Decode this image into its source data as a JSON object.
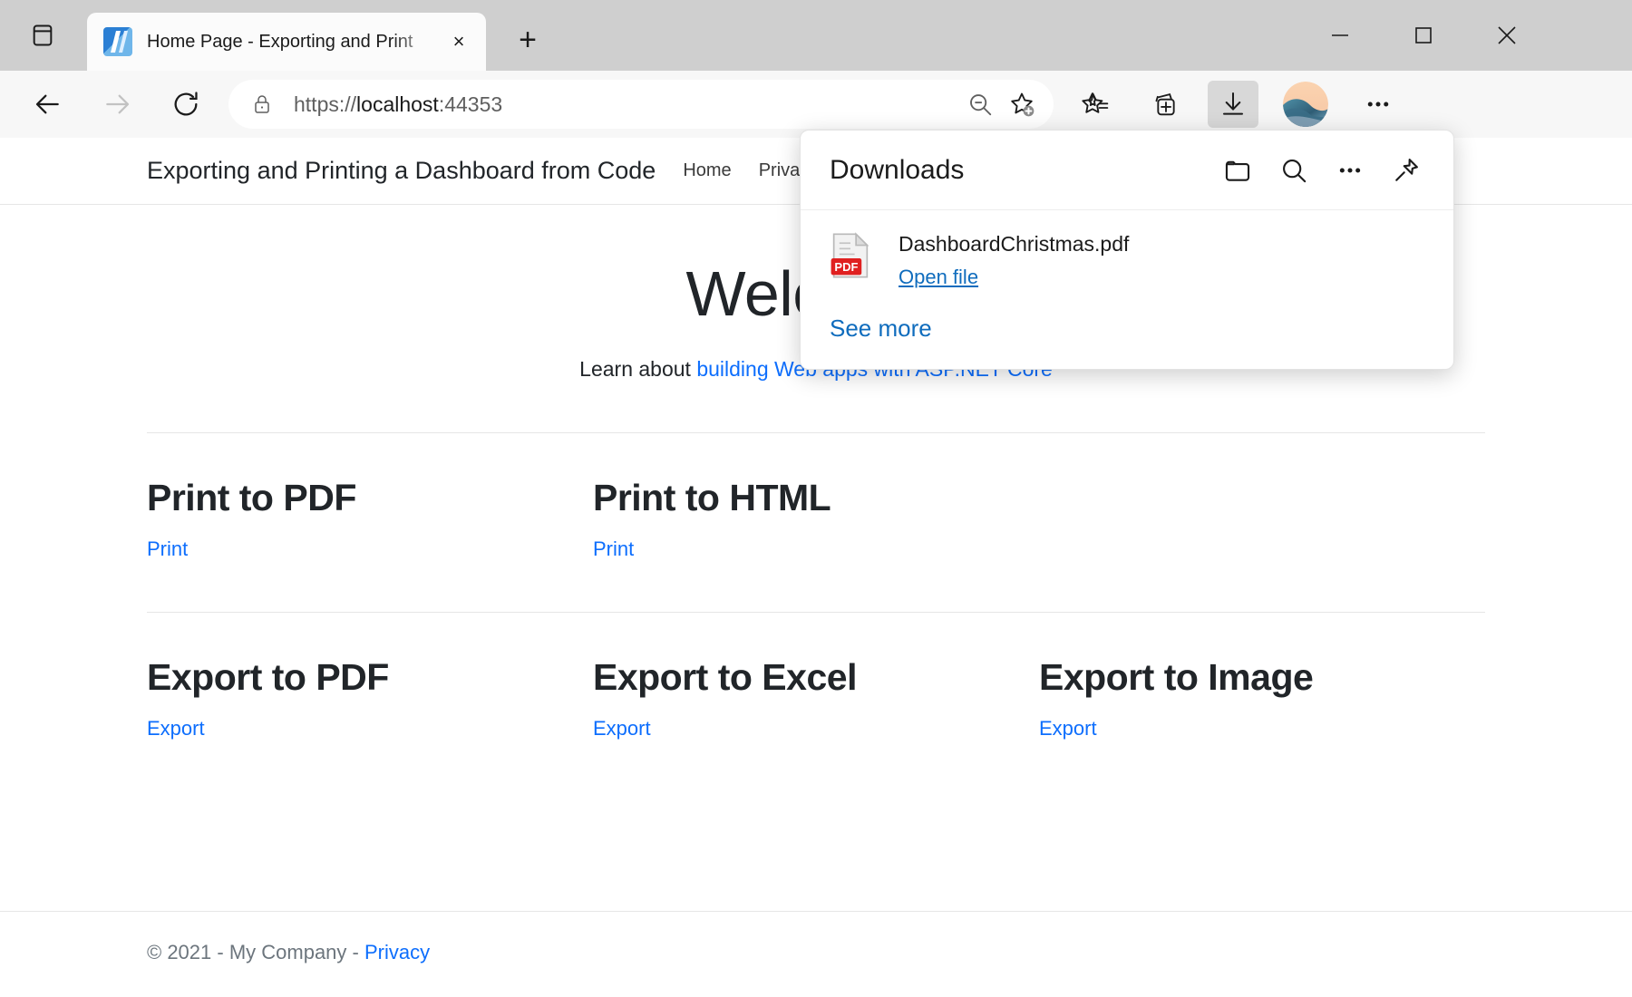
{
  "window": {
    "minimize_label": "Minimize",
    "maximize_label": "Maximize",
    "close_label": "Close"
  },
  "browser": {
    "tab_strip_button": "tab-actions",
    "tab": {
      "title": "Home Page - Exporting and Print",
      "favicon": "visual-studio-favicon",
      "close_label": "×"
    },
    "new_tab_label": "+",
    "toolbar": {
      "back": "back-arrow",
      "forward": "forward-arrow",
      "reload": "reload-arrow",
      "url_scheme": "https://",
      "url_host": "localhost",
      "url_rest": ":44353",
      "url_full": "https://localhost:44353",
      "zoom_out_tooltip": "Zoom out",
      "add_favorite_tooltip": "Add this page to favorites",
      "favorites_tooltip": "Favorites",
      "collections_tooltip": "Collections",
      "downloads_tooltip": "Downloads",
      "profile_tooltip": "Profile",
      "settings_tooltip": "Settings and more"
    }
  },
  "downloads_flyout": {
    "title": "Downloads",
    "icons": {
      "folder": "open-downloads-folder",
      "search": "search-downloads",
      "more": "more-options",
      "pin": "keep-open"
    },
    "items": [
      {
        "filename": "DashboardChristmas.pdf",
        "file_type": "PDF",
        "action_label": "Open file"
      }
    ],
    "see_more_label": "See more"
  },
  "site": {
    "brand": "Exporting and Printing a Dashboard from Code",
    "nav": [
      {
        "label": "Home"
      },
      {
        "label": "Privacy"
      }
    ],
    "hero": {
      "heading": "Welcome",
      "lead_prefix": "Learn about ",
      "lead_link": "building Web apps with ASP.NET Core"
    },
    "cards_row_1": [
      {
        "title": "Print to PDF",
        "link": "Print"
      },
      {
        "title": "Print to HTML",
        "link": "Print"
      }
    ],
    "cards_row_2": [
      {
        "title": "Export to PDF",
        "link": "Export"
      },
      {
        "title": "Export to Excel",
        "link": "Export"
      },
      {
        "title": "Export to Image",
        "link": "Export"
      }
    ],
    "footer": {
      "copyright": "© 2021 - My Company - ",
      "privacy_link": "Privacy"
    }
  },
  "colors": {
    "link": "#0d6efd",
    "flyout_link": "#0f6cbd",
    "titlebar": "#cfcfcf",
    "toolbar": "#f7f7f7",
    "pdf_badge": "#e02020"
  }
}
